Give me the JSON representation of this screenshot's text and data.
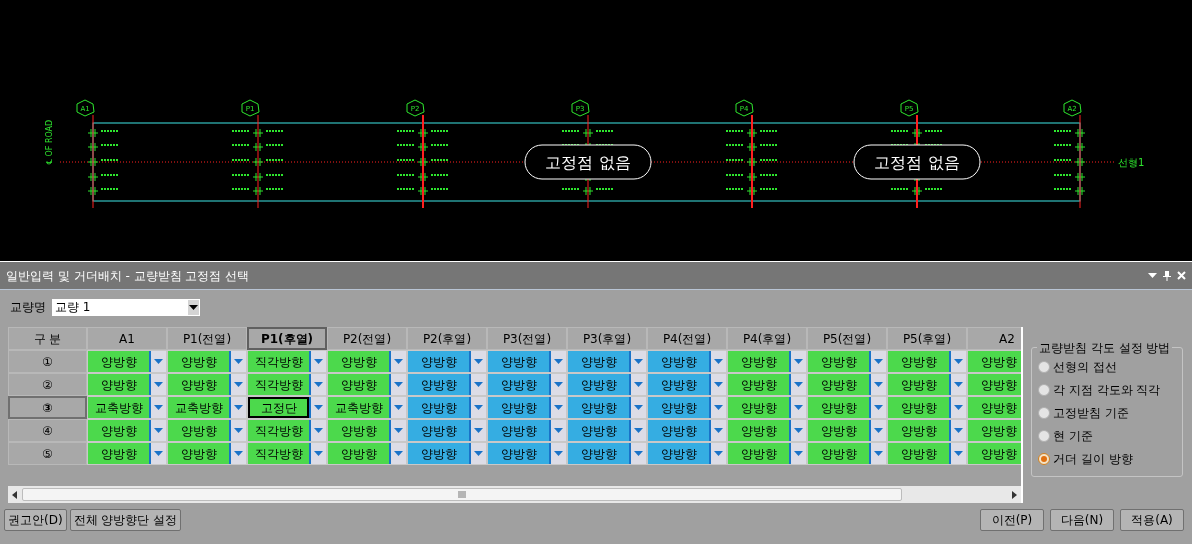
{
  "drawing": {
    "road_label": "℄ OF ROAD",
    "alignment_label": "선형1",
    "piers": [
      {
        "label": "A1"
      },
      {
        "label": "P1"
      },
      {
        "label": "P2"
      },
      {
        "label": "P3"
      },
      {
        "label": "P4"
      },
      {
        "label": "P5"
      },
      {
        "label": "A2"
      }
    ],
    "callouts": [
      {
        "label": "고정점 없음"
      },
      {
        "label": "고정점 없음"
      }
    ]
  },
  "panel": {
    "title": "일반입력 및 거더배치 - 교량받침 고정점 선택",
    "bridge_label": "교량명",
    "bridge_value": "교량 1",
    "grid": {
      "corner": "구 분",
      "columns": [
        {
          "label": "A1",
          "selected": false
        },
        {
          "label": "P1(전열)",
          "selected": false
        },
        {
          "label": "P1(후열)",
          "selected": true
        },
        {
          "label": "P2(전열)",
          "selected": false
        },
        {
          "label": "P2(후열)",
          "selected": false
        },
        {
          "label": "P3(전열)",
          "selected": false
        },
        {
          "label": "P3(후열)",
          "selected": false
        },
        {
          "label": "P4(전열)",
          "selected": false
        },
        {
          "label": "P4(후열)",
          "selected": false
        },
        {
          "label": "P5(전열)",
          "selected": false
        },
        {
          "label": "P5(후열)",
          "selected": false
        },
        {
          "label": "A2",
          "selected": false
        }
      ],
      "rows": [
        {
          "label": "①",
          "selected": false,
          "cells": [
            {
              "value": "양방향",
              "color": "#4cd94c",
              "selected": false
            },
            {
              "value": "양방향",
              "color": "#4cd94c",
              "selected": false
            },
            {
              "value": "직각방향",
              "color": "#4cd94c",
              "selected": false
            },
            {
              "value": "양방향",
              "color": "#4cd94c",
              "selected": false
            },
            {
              "value": "양방향",
              "color": "#35ade2",
              "selected": false
            },
            {
              "value": "양방향",
              "color": "#35ade2",
              "selected": false
            },
            {
              "value": "양방향",
              "color": "#35ade2",
              "selected": false
            },
            {
              "value": "양방향",
              "color": "#35ade2",
              "selected": false
            },
            {
              "value": "양방향",
              "color": "#4cd94c",
              "selected": false
            },
            {
              "value": "양방향",
              "color": "#4cd94c",
              "selected": false
            },
            {
              "value": "양방향",
              "color": "#4cd94c",
              "selected": false
            },
            {
              "value": "양방향",
              "color": "#4cd94c",
              "selected": false
            }
          ]
        },
        {
          "label": "②",
          "selected": false,
          "cells": [
            {
              "value": "양방향",
              "color": "#4cd94c",
              "selected": false
            },
            {
              "value": "양방향",
              "color": "#4cd94c",
              "selected": false
            },
            {
              "value": "직각방향",
              "color": "#4cd94c",
              "selected": false
            },
            {
              "value": "양방향",
              "color": "#4cd94c",
              "selected": false
            },
            {
              "value": "양방향",
              "color": "#35ade2",
              "selected": false
            },
            {
              "value": "양방향",
              "color": "#35ade2",
              "selected": false
            },
            {
              "value": "양방향",
              "color": "#35ade2",
              "selected": false
            },
            {
              "value": "양방향",
              "color": "#35ade2",
              "selected": false
            },
            {
              "value": "양방향",
              "color": "#4cd94c",
              "selected": false
            },
            {
              "value": "양방향",
              "color": "#4cd94c",
              "selected": false
            },
            {
              "value": "양방향",
              "color": "#4cd94c",
              "selected": false
            },
            {
              "value": "양방향",
              "color": "#4cd94c",
              "selected": false
            }
          ]
        },
        {
          "label": "③",
          "selected": true,
          "cells": [
            {
              "value": "교축방향",
              "color": "#4cd94c",
              "selected": false
            },
            {
              "value": "교축방향",
              "color": "#4cd94c",
              "selected": false
            },
            {
              "value": "고정단",
              "color": "#4cd94c",
              "selected": true
            },
            {
              "value": "교축방향",
              "color": "#4cd94c",
              "selected": false
            },
            {
              "value": "양방향",
              "color": "#35ade2",
              "selected": false
            },
            {
              "value": "양방향",
              "color": "#35ade2",
              "selected": false
            },
            {
              "value": "양방향",
              "color": "#35ade2",
              "selected": false
            },
            {
              "value": "양방향",
              "color": "#35ade2",
              "selected": false
            },
            {
              "value": "양방향",
              "color": "#4cd94c",
              "selected": false
            },
            {
              "value": "양방향",
              "color": "#4cd94c",
              "selected": false
            },
            {
              "value": "양방향",
              "color": "#4cd94c",
              "selected": false
            },
            {
              "value": "양방향",
              "color": "#4cd94c",
              "selected": false
            }
          ]
        },
        {
          "label": "④",
          "selected": false,
          "cells": [
            {
              "value": "양방향",
              "color": "#4cd94c",
              "selected": false
            },
            {
              "value": "양방향",
              "color": "#4cd94c",
              "selected": false
            },
            {
              "value": "직각방향",
              "color": "#4cd94c",
              "selected": false
            },
            {
              "value": "양방향",
              "color": "#4cd94c",
              "selected": false
            },
            {
              "value": "양방향",
              "color": "#35ade2",
              "selected": false
            },
            {
              "value": "양방향",
              "color": "#35ade2",
              "selected": false
            },
            {
              "value": "양방향",
              "color": "#35ade2",
              "selected": false
            },
            {
              "value": "양방향",
              "color": "#35ade2",
              "selected": false
            },
            {
              "value": "양방향",
              "color": "#4cd94c",
              "selected": false
            },
            {
              "value": "양방향",
              "color": "#4cd94c",
              "selected": false
            },
            {
              "value": "양방향",
              "color": "#4cd94c",
              "selected": false
            },
            {
              "value": "양방향",
              "color": "#4cd94c",
              "selected": false
            }
          ]
        },
        {
          "label": "⑤",
          "selected": false,
          "cells": [
            {
              "value": "양방향",
              "color": "#4cd94c",
              "selected": false
            },
            {
              "value": "양방향",
              "color": "#4cd94c",
              "selected": false
            },
            {
              "value": "직각방향",
              "color": "#4cd94c",
              "selected": false
            },
            {
              "value": "양방향",
              "color": "#4cd94c",
              "selected": false
            },
            {
              "value": "양방향",
              "color": "#35ade2",
              "selected": false
            },
            {
              "value": "양방향",
              "color": "#35ade2",
              "selected": false
            },
            {
              "value": "양방향",
              "color": "#35ade2",
              "selected": false
            },
            {
              "value": "양방향",
              "color": "#35ade2",
              "selected": false
            },
            {
              "value": "양방향",
              "color": "#4cd94c",
              "selected": false
            },
            {
              "value": "양방향",
              "color": "#4cd94c",
              "selected": false
            },
            {
              "value": "양방향",
              "color": "#4cd94c",
              "selected": false
            },
            {
              "value": "양방향",
              "color": "#4cd94c",
              "selected": false
            }
          ]
        }
      ]
    },
    "angle_group": {
      "title": "교량받침 각도 설정 방법",
      "options": [
        {
          "label": "선형의 접선",
          "selected": false
        },
        {
          "label": "각 지점 각도와 직각",
          "selected": false
        },
        {
          "label": "고정받침 기준",
          "selected": false
        },
        {
          "label": "현 기준",
          "selected": false
        },
        {
          "label": "거더 길이 방향",
          "selected": true
        }
      ]
    },
    "left_buttons": [
      "권고안(D)",
      "전체 양방향단 설정"
    ],
    "right_buttons": [
      "이전(P)",
      "다음(N)",
      "적용(A)"
    ]
  }
}
